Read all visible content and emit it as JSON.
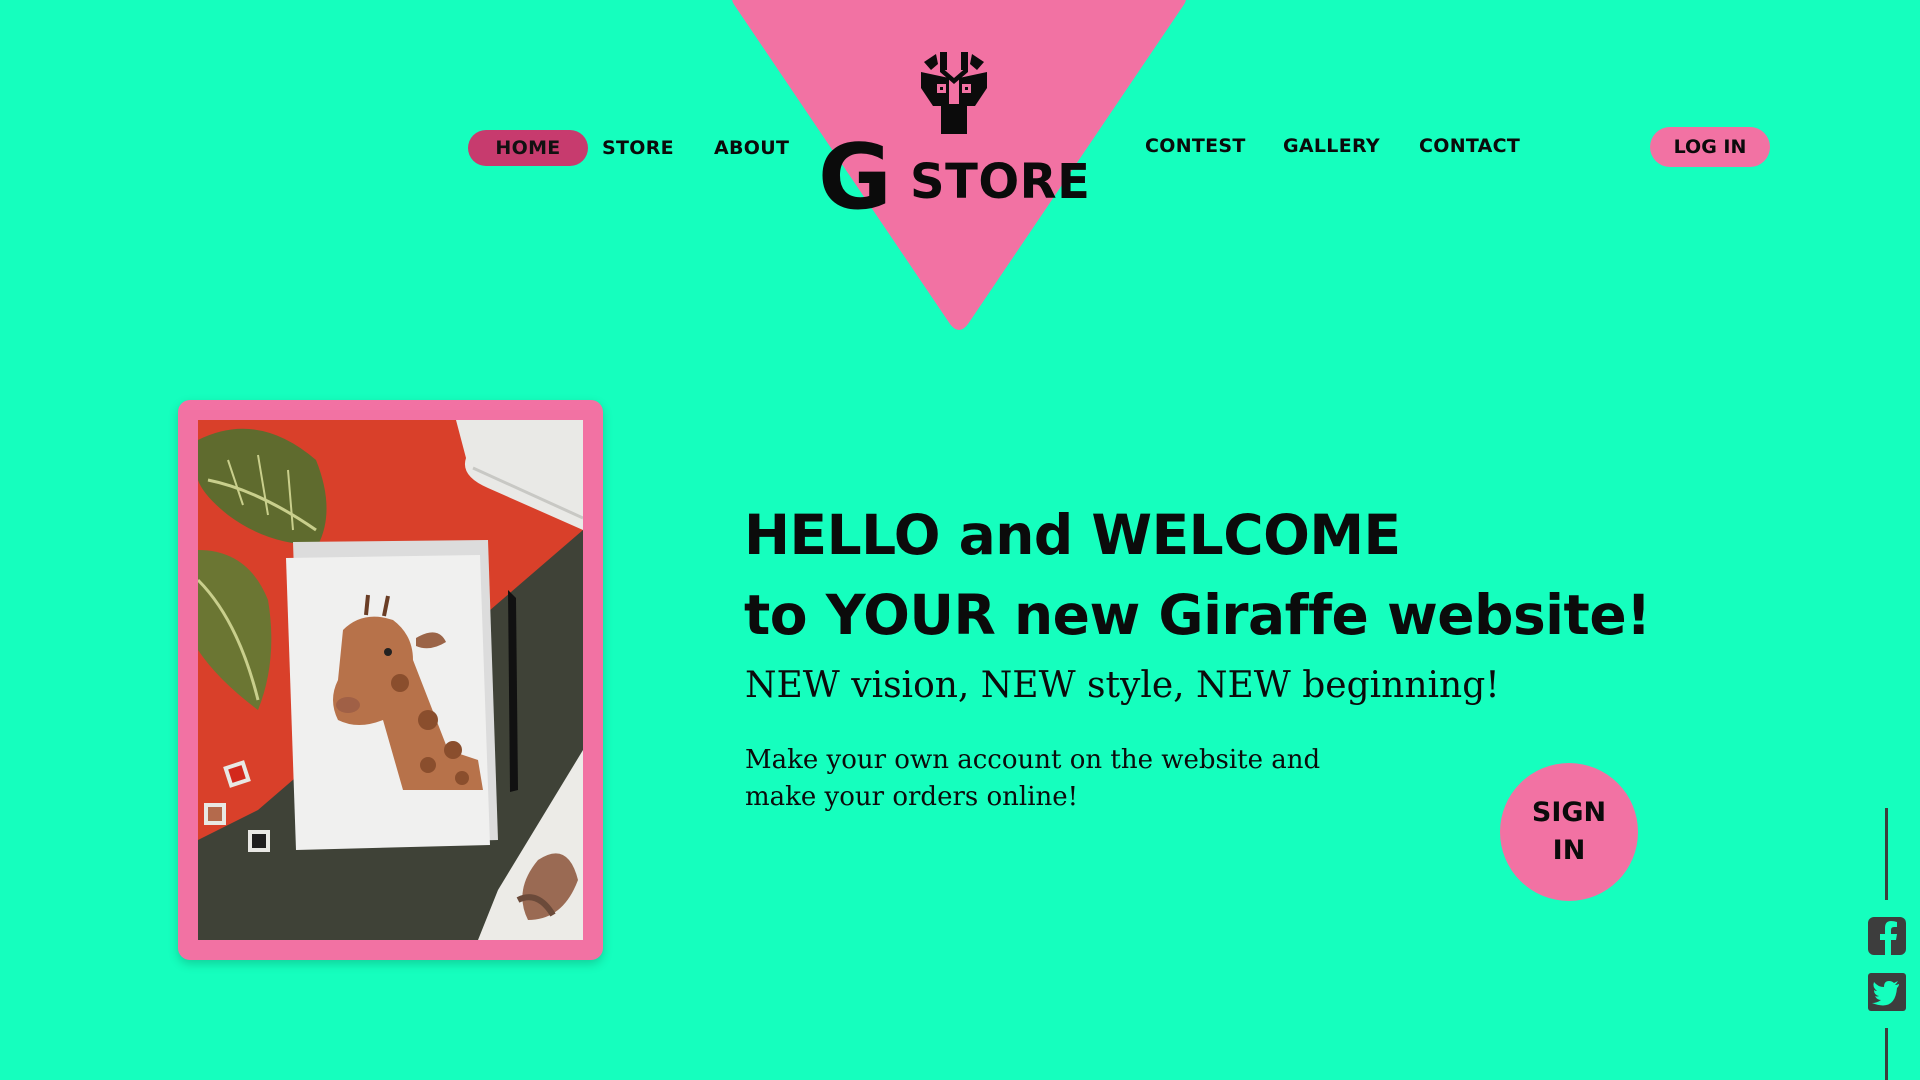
{
  "nav": {
    "left": [
      {
        "label": "HOME",
        "active": true
      },
      {
        "label": "STORE"
      },
      {
        "label": "ABOUT"
      }
    ],
    "right": [
      {
        "label": "CONTEST"
      },
      {
        "label": "GALLERY"
      },
      {
        "label": "CONTACT"
      }
    ],
    "login_label": "LOG IN"
  },
  "logo": {
    "letter": "G",
    "text": "STORE",
    "icon": "giraffe-head-icon"
  },
  "hero": {
    "image": "watercolor-giraffe-card-photo",
    "headline_line1": "HELLO and WELCOME",
    "headline_line2": "to YOUR new Giraffe website!",
    "subline": "NEW vision, NEW style, NEW beginning!",
    "body": "Make your own account on the website and make your orders online!",
    "signin_label": "SIGN IN"
  },
  "social": {
    "items": [
      {
        "icon": "facebook-icon"
      },
      {
        "icon": "twitter-icon"
      }
    ]
  },
  "colors": {
    "background": "#15FFBE",
    "accent_pink": "#F272A3",
    "active_pink": "#C73B6E",
    "text": "#0B0B0B"
  }
}
